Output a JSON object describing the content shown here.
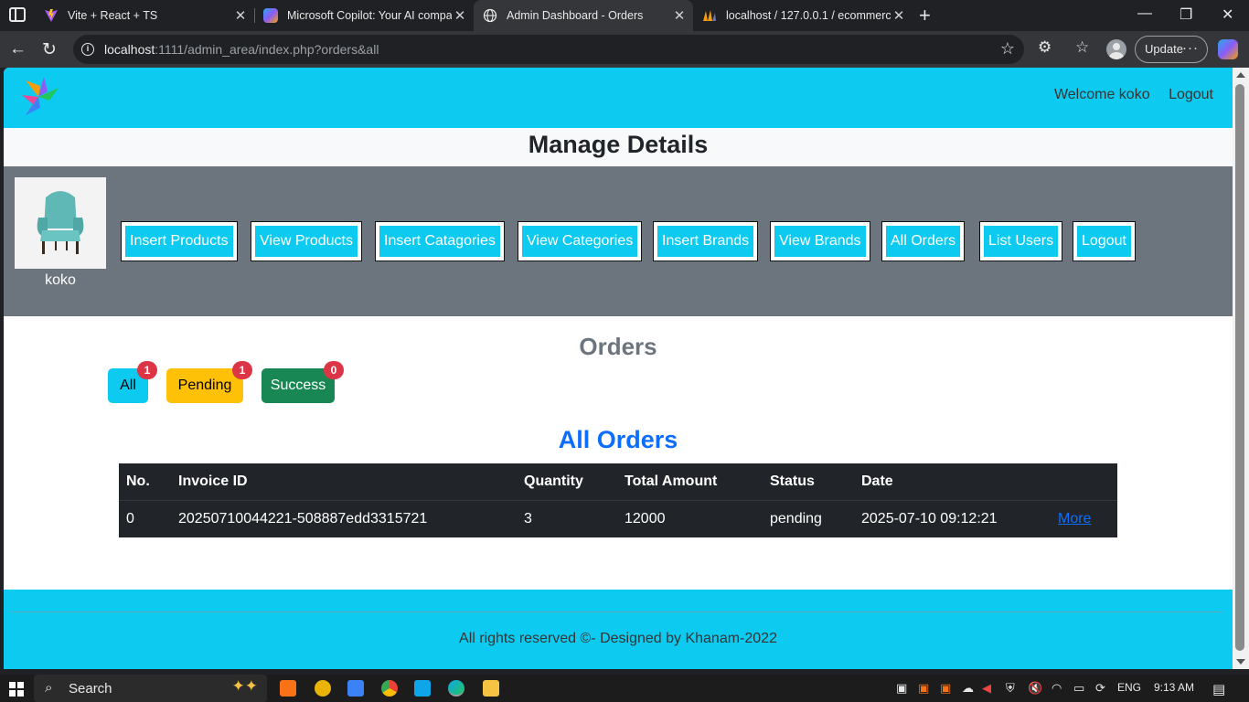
{
  "browser": {
    "tabs": [
      {
        "title": "Vite + React + TS",
        "icon": "vite-icon"
      },
      {
        "title": "Microsoft Copilot: Your AI compa",
        "icon": "copilot-icon"
      },
      {
        "title": "Admin Dashboard - Orders",
        "icon": "globe-icon",
        "active": true
      },
      {
        "title": "localhost / 127.0.0.1 / ecommerce",
        "icon": "phpmyadmin-icon"
      }
    ],
    "url_host": "localhost",
    "url_rest": ":1111/admin_area/index.php?orders&all",
    "update_label": "Update"
  },
  "site": {
    "welcome": "Welcome koko",
    "logout": "Logout",
    "manage_title": "Manage Details",
    "admin_name": "koko",
    "menu": [
      "Insert Products",
      "View Products",
      "Insert Catagories",
      "View Categories",
      "Insert Brands",
      "View Brands",
      "All Orders",
      "List Users",
      "Logout"
    ],
    "orders_heading": "Orders",
    "filters": [
      {
        "label": "All",
        "count": "1",
        "color": "#0dcaf0"
      },
      {
        "label": "Pending",
        "count": "1",
        "color": "#ffc107"
      },
      {
        "label": "Success",
        "count": "0",
        "color": "#198754"
      }
    ],
    "table_title": "All Orders",
    "table": {
      "headers": [
        "No.",
        "Invoice ID",
        "Quantity",
        "Total Amount",
        "Status",
        "Date"
      ],
      "rows": [
        {
          "no": "0",
          "invoice": "20250710044221-508887edd3315721",
          "quantity": "3",
          "total": "12000",
          "status": "pending",
          "date": "2025-07-10 09:12:21",
          "action": "More"
        }
      ]
    },
    "footer": "All rights reserved ©- Designed by Khanam-2022"
  },
  "taskbar": {
    "search_label": "Search",
    "language": "ENG",
    "time": "9:13 AM"
  }
}
